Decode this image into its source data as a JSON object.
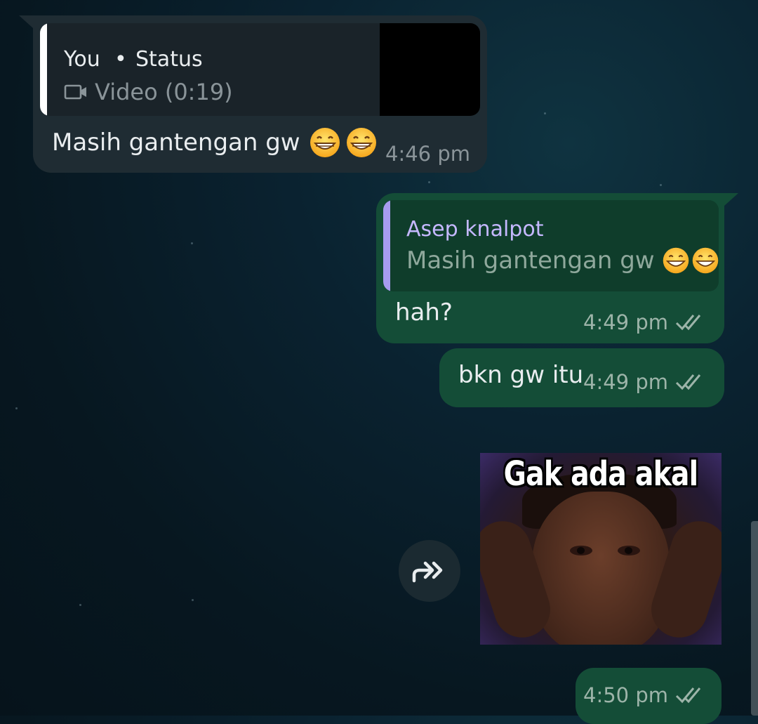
{
  "incoming_message": {
    "quoted": {
      "author": "You",
      "separator": "•",
      "source": "Status",
      "media_label": "Video (0:19)",
      "media_icon": "video-icon"
    },
    "text": "Masih gantengan gw",
    "emojis": [
      "grinning-face-emoji",
      "grinning-face-emoji"
    ],
    "time": "4:46 pm"
  },
  "outgoing_reply": {
    "quoted": {
      "author": "Asep knalpot",
      "text": "Masih gantengan gw",
      "emojis": [
        "grinning-face-emoji",
        "grinning-face-emoji"
      ]
    },
    "text": "hah?",
    "time": "4:49 pm",
    "status_icon": "double-check-icon"
  },
  "outgoing_message_2": {
    "text": "bkn gw itu",
    "time": "4:49 pm",
    "status_icon": "double-check-icon"
  },
  "sticker_message": {
    "caption": "Gak ada akal",
    "time": "4:50 pm",
    "status_icon": "double-check-icon",
    "forward_icon": "forward-icon"
  },
  "colors": {
    "incoming_bubble": "#1f2c33",
    "outgoing_bubble": "#144d37",
    "quote_bar_incoming": "#ffffff",
    "quote_bar_outgoing": "#a79cf0",
    "quote_author_outgoing": "#c5b8ff"
  }
}
